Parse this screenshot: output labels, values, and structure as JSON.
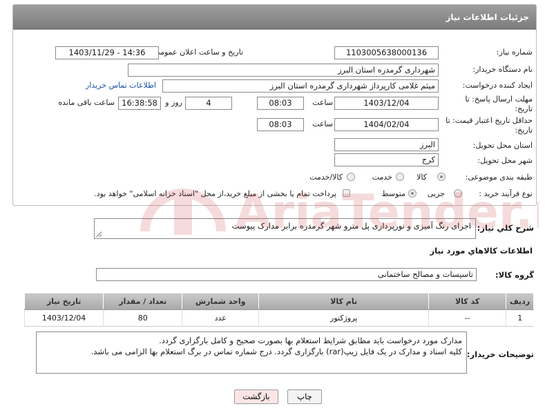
{
  "header": {
    "title": "جزئیات اطلاعات نیاز"
  },
  "labels": {
    "need_number": "شماره نیاز:",
    "announce_datetime": "تاریخ و ساعت اعلان عمومی:",
    "buyer_org": "نام دستگاه خریدار:",
    "creator": "ایجاد کننده درخواست:",
    "reply_deadline": "مهلت ارسال پاسخ: تا تاریخ:",
    "price_validity": "حداقل تاریخ اعتبار قیمت: تا تاریخ:",
    "time": "ساعت",
    "day_and": "روز و",
    "hours_left": "ساعت باقی مانده",
    "province": "استان محل تحویل:",
    "city": "شهر محل تحویل:",
    "category": "طبقه بندی موضوعی:",
    "process_type": "نوع فرآیند خرید :",
    "description": "شرح کلي نياز:",
    "goods_info": "اطلاعات کالاهاي مورد نياز",
    "goods_group": "گروه کالا:",
    "buyer_notes": "توضیحات خریدار:"
  },
  "fields": {
    "need_number": "1103005638000136",
    "announce_datetime": "1403/11/29 - 14:36",
    "buyer_org": "شهرداری گرمدره استان البرز",
    "creator": "میثم غلامی کارپرداز شهرداری گرمدره استان البرز",
    "contact_link": "اطلاعات تماس خریدار",
    "reply_date": "1403/12/04",
    "reply_time": "08:03",
    "days": "4",
    "remaining": "16:38:58",
    "validity_date": "1404/02/04",
    "validity_time": "08:03",
    "province": "البرز",
    "city": "کرج"
  },
  "category_options": [
    {
      "label": "کالا",
      "selected": true
    },
    {
      "label": "خدمت",
      "selected": false
    },
    {
      "label": "کالا/خدمت",
      "selected": false
    }
  ],
  "process_options": [
    {
      "label": "جزیی",
      "selected": false
    },
    {
      "label": "متوسط",
      "selected": true
    }
  ],
  "payment_note": "پرداخت تمام یا بخشی از مبلغ خرید،از محل \"اسناد خزانه اسلامی\" خواهد بود.",
  "description": "اجرای رنگ آمیزی و نورپردازی پل مترو شهر گرمدره برابر مدارک پیوست",
  "goods_group": "تاسیسات و مصالح ساختمانی",
  "table": {
    "headers": [
      "ردیف",
      "کد کالا",
      "نام کالا",
      "واحد شمارش",
      "تعداد / مقدار",
      "تاریخ نیاز"
    ],
    "rows": [
      [
        "1",
        "--",
        "پروژکتور",
        "عدد",
        "80",
        "1403/12/04"
      ]
    ]
  },
  "buyer_notes": [
    "مدارک مورد درخواست باید مطابق شرایط استعلام بها بصورت صحیح و کامل بارگزاری گردد.",
    "کلیه اسناد و مدارک در یک فایل زیپ(rar) بارگزاری گردد.  درج شماره تماس در برگ استعلام بها الزامی می باشد."
  ],
  "buttons": {
    "print": "چاپ",
    "back": "بازگشت"
  },
  "watermark": "AriaTender.net",
  "colors": {
    "header_bg": "#8c8c8c",
    "link": "#1a4fa8",
    "back_button_bg": "#fde5e5",
    "watermark": "#c62828"
  }
}
